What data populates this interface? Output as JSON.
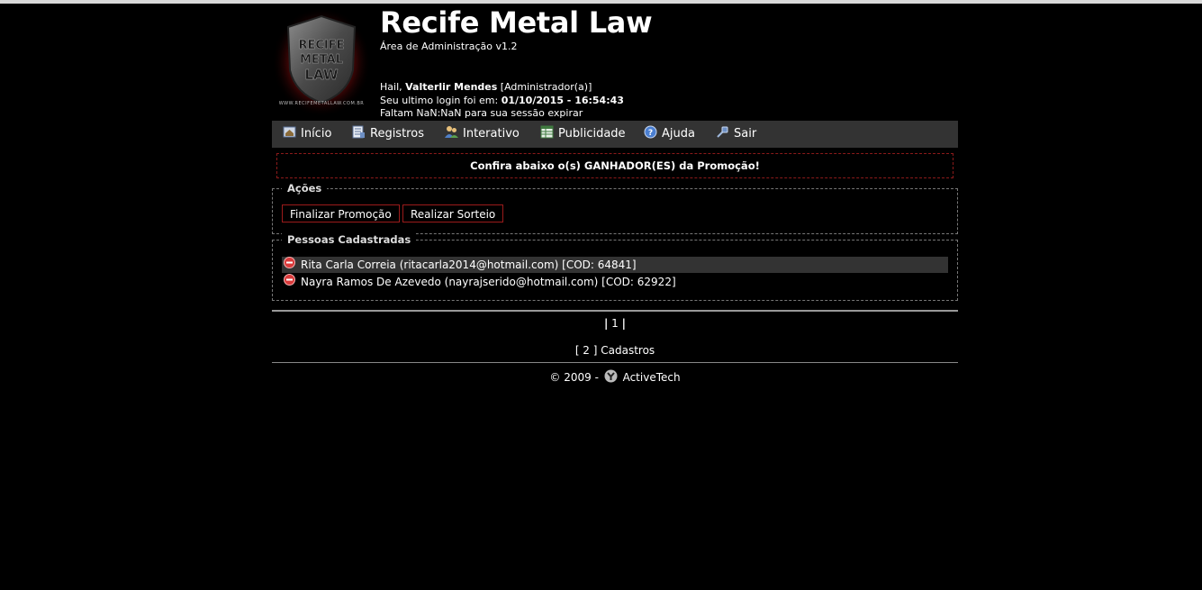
{
  "header": {
    "logo_lines": [
      "RECIFE",
      "METAL",
      "LAW"
    ],
    "logo_url_text": "WWW.RECIFEMETALLAW.COM.BR",
    "title": "Recife Metal Law",
    "subtitle": "Área de Administração v1.2",
    "greeting": "Hail,",
    "user_name": "Valterlir Mendes",
    "user_role": "[Administrador(a)]",
    "last_login_label": "Seu ultimo login foi em:",
    "last_login_value": "01/10/2015 - 16:54:43",
    "session_text": "Faltam NaN:NaN para sua sessão expirar"
  },
  "menu": [
    {
      "label": "Início",
      "icon": "home-icon"
    },
    {
      "label": "Registros",
      "icon": "records-icon"
    },
    {
      "label": "Interativo",
      "icon": "users-icon"
    },
    {
      "label": "Publicidade",
      "icon": "table-icon"
    },
    {
      "label": "Ajuda",
      "icon": "help-icon"
    },
    {
      "label": "Sair",
      "icon": "exit-icon"
    }
  ],
  "notice": "Confira abaixo o(s) GANHADOR(ES) da Promoção!",
  "actions": {
    "legend": "Ações",
    "finalize_label": "Finalizar Promoção",
    "draw_label": "Realizar Sorteio"
  },
  "people": {
    "legend": "Pessoas Cadastradas",
    "items": [
      "Rita Carla Correia (ritacarla2014@hotmail.com) [COD: 64841]",
      "Nayra Ramos De Azevedo (nayrajserido@hotmail.com) [COD: 62922]"
    ]
  },
  "pager": {
    "prefix": "|",
    "current": "1",
    "suffix": "|"
  },
  "count_text": "[ 2 ] Cadastros",
  "footer": {
    "copyright": "© 2009 -",
    "brand": "ActiveTech"
  },
  "colors": {
    "accent_red": "#9b1b1b",
    "menu_bg": "#333333",
    "background": "#000000"
  }
}
